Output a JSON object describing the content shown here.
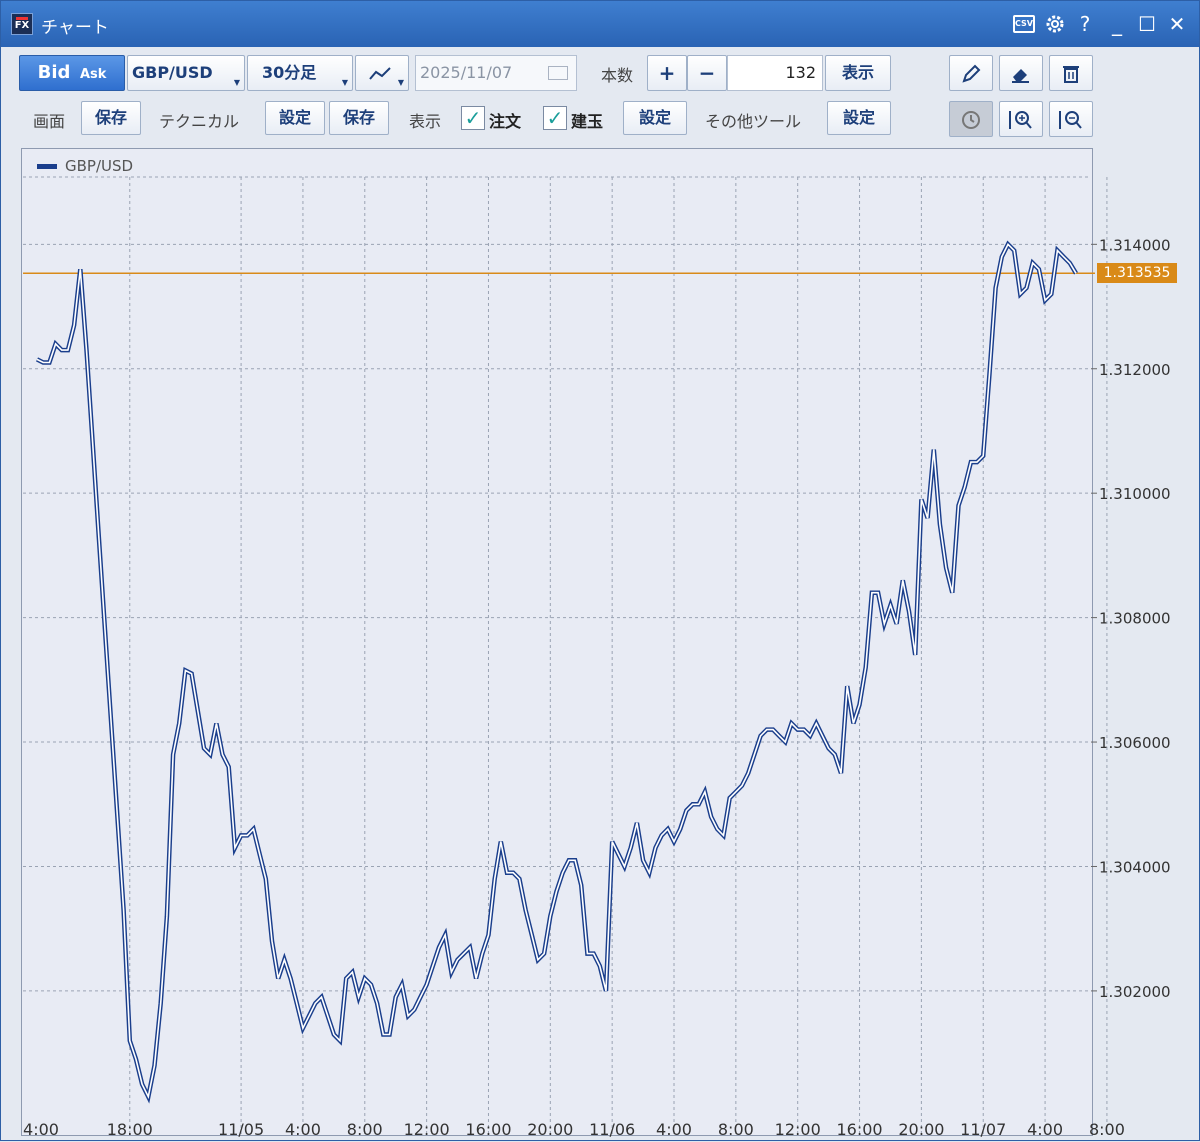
{
  "window": {
    "title": "チャート",
    "app_icon_text": "FX",
    "controls": {
      "csv": "CSV",
      "help": "?",
      "minimize": "_",
      "maximize": "☐",
      "close": "✕"
    }
  },
  "toolbar1": {
    "bid": "Bid",
    "ask": "Ask",
    "symbol": "GBP/USD",
    "timeframe": "30分足",
    "chart_type_icon": "line-chart-icon",
    "date": "2025/11/07",
    "count_label": "本数",
    "plus": "+",
    "minus": "−",
    "count": "132",
    "show": "表示"
  },
  "toolbar2": {
    "screen_label": "画面",
    "screen_save": "保存",
    "technical_label": "テクニカル",
    "technical_settings": "設定",
    "technical_save": "保存",
    "display_label": "表示",
    "orders_label": "注文",
    "orders_checked": true,
    "positions_label": "建玉",
    "positions_checked": true,
    "display_settings": "設定",
    "other_tools_label": "その他ツール",
    "other_tools_settings": "設定"
  },
  "colors": {
    "line": "#1a3e8c",
    "current_price": "#d98a18",
    "grid": "#9aa3b3",
    "accent": "#2f6fcf"
  },
  "chart_data": {
    "type": "line",
    "legend": "GBP/USD",
    "current_price_label": "1.313535",
    "current_price": 1.313535,
    "ylim": [
      1.2997,
      1.3155
    ],
    "yticks": [
      1.302,
      1.304,
      1.306,
      1.308,
      1.31,
      1.312,
      1.314
    ],
    "ytick_labels": [
      "1.302000",
      "1.304000",
      "1.306000",
      "1.308000",
      "1.310000",
      "1.312000",
      "1.314000"
    ],
    "xtick_labels": [
      "4:00",
      "18:00",
      "11/05",
      "4:00",
      "8:00",
      "12:00",
      "16:00",
      "20:00",
      "11/06",
      "4:00",
      "8:00",
      "12:00",
      "16:00",
      "20:00",
      "11/07",
      "4:00",
      "8:00"
    ],
    "xtick_idx": [
      0,
      15,
      33,
      43,
      53,
      63,
      73,
      83,
      93,
      103,
      113,
      123,
      133,
      143,
      153,
      163,
      173
    ],
    "grid": true,
    "series": [
      {
        "name": "GBP/USD",
        "values": [
          1.31215,
          1.3121,
          1.3121,
          1.3124,
          1.3123,
          1.3123,
          1.3127,
          1.3136,
          1.3123,
          1.3108,
          1.3093,
          1.3078,
          1.3063,
          1.3048,
          1.3033,
          1.3012,
          1.3009,
          1.3005,
          1.3003,
          1.3008,
          1.3018,
          1.3032,
          1.3058,
          1.3063,
          1.30715,
          1.3071,
          1.3065,
          1.3059,
          1.3058,
          1.3063,
          1.3058,
          1.3056,
          1.3043,
          1.3045,
          1.3045,
          1.3046,
          1.3042,
          1.3038,
          1.3028,
          1.3022,
          1.3025,
          1.3022,
          1.3018,
          1.3014,
          1.3016,
          1.3018,
          1.3019,
          1.3016,
          1.3013,
          1.3012,
          1.3022,
          1.3023,
          1.3019,
          1.3022,
          1.3021,
          1.3018,
          1.3013,
          1.3013,
          1.3019,
          1.3021,
          1.3016,
          1.3017,
          1.3019,
          1.3021,
          1.3024,
          1.3027,
          1.3029,
          1.3023,
          1.3025,
          1.3026,
          1.3027,
          1.3022,
          1.3026,
          1.3029,
          1.3038,
          1.3044,
          1.3039,
          1.3039,
          1.3038,
          1.3033,
          1.3029,
          1.3025,
          1.3026,
          1.3032,
          1.3036,
          1.3039,
          1.3041,
          1.3041,
          1.3037,
          1.3026,
          1.3026,
          1.3024,
          1.302,
          1.3044,
          1.3042,
          1.304,
          1.3043,
          1.3047,
          1.3041,
          1.3039,
          1.3043,
          1.3045,
          1.3046,
          1.3044,
          1.3046,
          1.3049,
          1.305,
          1.305,
          1.3052,
          1.3048,
          1.3046,
          1.3045,
          1.3051,
          1.3052,
          1.3053,
          1.3055,
          1.3058,
          1.3061,
          1.3062,
          1.3062,
          1.3061,
          1.306,
          1.3063,
          1.3062,
          1.3062,
          1.3061,
          1.3063,
          1.3061,
          1.3059,
          1.3058,
          1.3055,
          1.3069,
          1.3063,
          1.3066,
          1.3072,
          1.3084,
          1.3084,
          1.3079,
          1.3082,
          1.3079,
          1.3086,
          1.3081,
          1.3074,
          1.3099,
          1.3096,
          1.3107,
          1.3095,
          1.3088,
          1.3084,
          1.3098,
          1.3101,
          1.3105,
          1.3105,
          1.3106,
          1.3119,
          1.3133,
          1.3138,
          1.314,
          1.3139,
          1.3132,
          1.3133,
          1.3137,
          1.3136,
          1.3131,
          1.3132,
          1.3139,
          1.3138,
          1.3137,
          1.313535
        ]
      }
    ]
  }
}
